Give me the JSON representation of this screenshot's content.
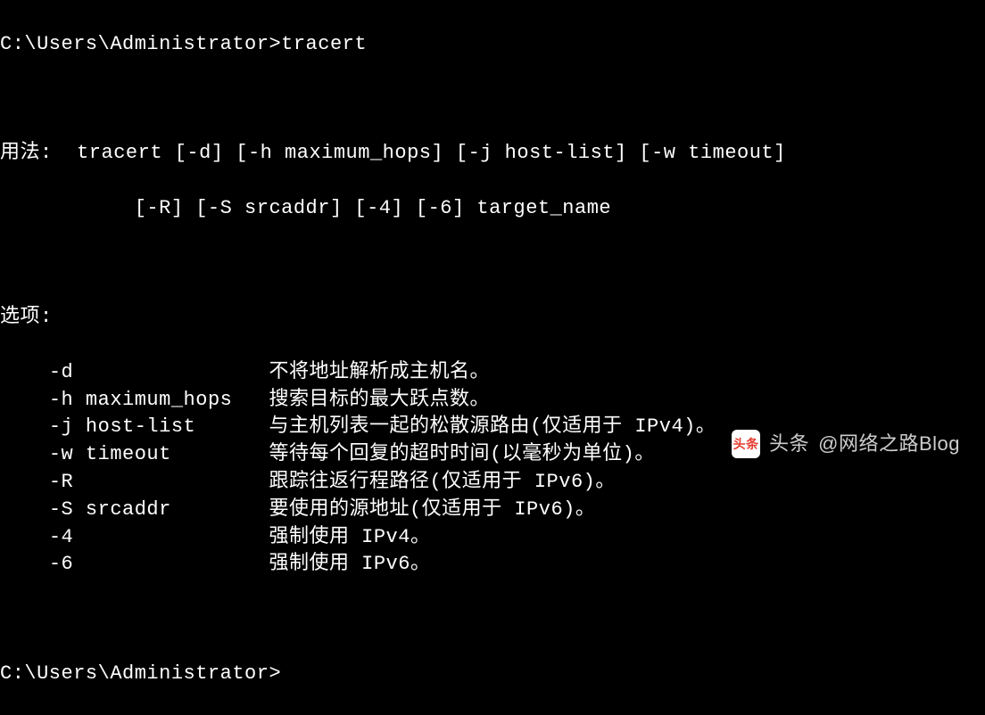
{
  "prompt1": {
    "path": "C:\\Users\\Administrator>",
    "command": "tracert"
  },
  "usage": {
    "label": "用法:",
    "line1": "  tracert [-d] [-h maximum_hops] [-j host-list] [-w timeout]",
    "line2": "           [-R] [-S srcaddr] [-4] [-6] target_name"
  },
  "options_label": "选项:",
  "options": [
    {
      "flag": "-d",
      "desc": "不将地址解析成主机名。"
    },
    {
      "flag": "-h maximum_hops",
      "desc": "搜索目标的最大跃点数。"
    },
    {
      "flag": "-j host-list",
      "desc": "与主机列表一起的松散源路由(仅适用于 IPv4)。"
    },
    {
      "flag": "-w timeout",
      "desc": "等待每个回复的超时时间(以毫秒为单位)。"
    },
    {
      "flag": "-R",
      "desc": "跟踪往返行程路径(仅适用于 IPv6)。"
    },
    {
      "flag": "-S srcaddr",
      "desc": "要使用的源地址(仅适用于 IPv6)。"
    },
    {
      "flag": "-4",
      "desc": "强制使用 IPv4。"
    },
    {
      "flag": "-6",
      "desc": "强制使用 IPv6。"
    }
  ],
  "prompt2": {
    "path": "C:\\Users\\Administrator>"
  },
  "watermark": {
    "label": "头条",
    "author": "@网络之路Blog"
  }
}
